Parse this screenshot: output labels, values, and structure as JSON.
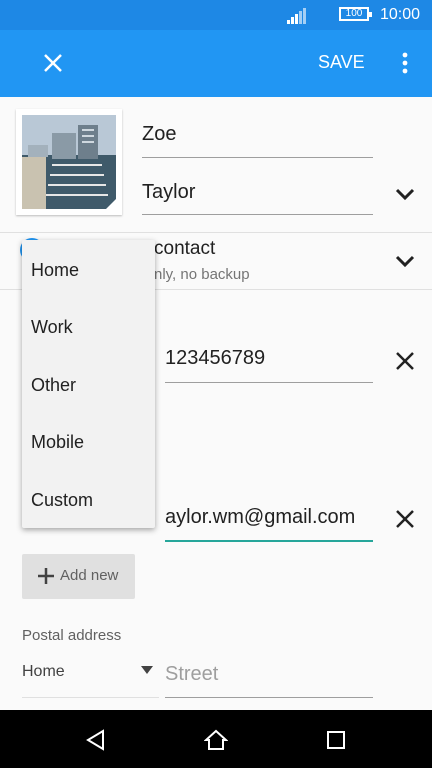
{
  "status_bar": {
    "battery": "100",
    "time": "10:00"
  },
  "toolbar": {
    "save_label": "SAVE"
  },
  "contact": {
    "first_name": "Zoe",
    "last_name": "Taylor",
    "account_title": "contact",
    "account_subtitle": "nly, no backup",
    "phone": "123456789",
    "email": "aylor.wm@gmail.com"
  },
  "add_new_label": "Add new",
  "postal": {
    "section_label": "Postal address",
    "type_value": "Home",
    "street_placeholder": "Street"
  },
  "dropdown": {
    "options": [
      "Home",
      "Work",
      "Other",
      "Mobile",
      "Custom"
    ]
  },
  "colors": {
    "accent": "#2196f3",
    "status_bar": "#1e88e5",
    "email_underline": "#26a69a"
  }
}
